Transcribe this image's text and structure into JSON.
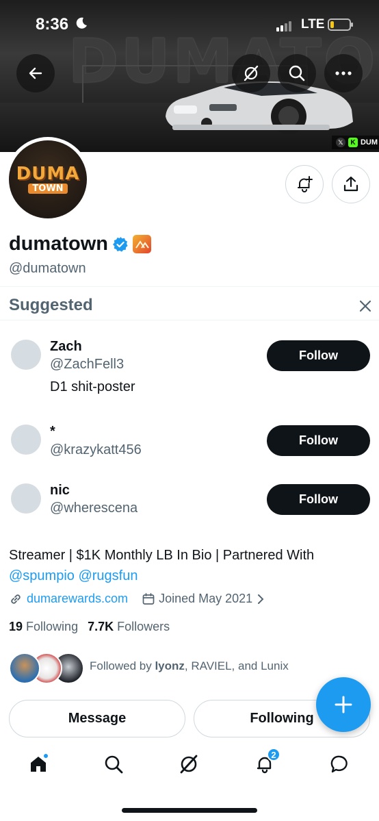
{
  "status_bar": {
    "time": "8:36",
    "network": "LTE"
  },
  "banner": {
    "wordmark": "DUMATOWN",
    "credit_text": "DUM"
  },
  "profile": {
    "avatar_line1": "DUMA",
    "avatar_line2": "TOWN",
    "display_name": "dumatown",
    "handle": "@dumatown",
    "bio_text": "Streamer | $1K Monthly LB In Bio | Partnered With",
    "bio_mention_1": "@spumpio",
    "bio_mention_2": "@rugsfun",
    "website": "dumarewards.com",
    "joined": "Joined May 2021",
    "following_count": "19",
    "following_label": "Following",
    "followers_count": "7.7K",
    "followers_label": "Followers",
    "followed_by_prefix": "Followed by ",
    "followed_by_name1": "lyonz",
    "followed_by_rest": ", RAVIEL, and Lunix"
  },
  "suggested": {
    "title": "Suggested",
    "items": [
      {
        "name": "Zach",
        "handle": "@ZachFell3",
        "bio": "D1 shit-poster",
        "button": "Follow"
      },
      {
        "name": "*",
        "handle": "@krazykatt456",
        "bio": "",
        "button": "Follow"
      },
      {
        "name": "nic",
        "handle": "@wherescena",
        "bio": "",
        "button": "Follow"
      }
    ]
  },
  "buttons": {
    "message": "Message",
    "following": "Following"
  },
  "nav": {
    "notifications_badge": "2"
  },
  "icons": [
    "back-arrow-icon",
    "grok-icon",
    "search-icon",
    "more-icon",
    "notification-plus-icon",
    "share-icon",
    "verified-icon",
    "close-icon",
    "link-icon",
    "calendar-icon",
    "chevron-right-icon",
    "compose-plus-icon",
    "home-icon",
    "bell-icon",
    "chat-icon"
  ],
  "colors": {
    "accent": "#1d9bf0",
    "text": "#0f1419",
    "secondary": "#536471",
    "button_dark": "#0f1419"
  }
}
